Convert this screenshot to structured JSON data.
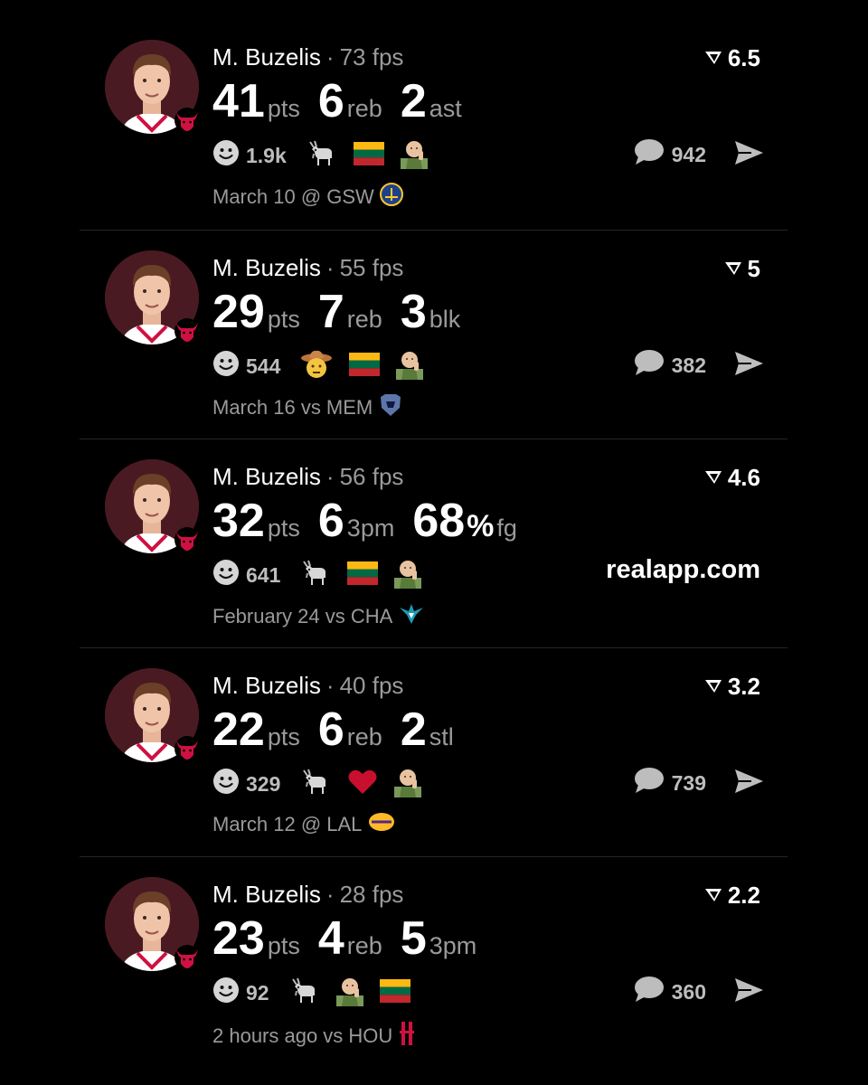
{
  "posts": [
    {
      "player": "M. Buzelis",
      "separator": "·",
      "fps": "73 fps",
      "rating": "6.5",
      "stats": [
        {
          "value": "41",
          "unit": "pts"
        },
        {
          "value": "6",
          "unit": "reb"
        },
        {
          "value": "2",
          "unit": "ast"
        }
      ],
      "reaction_count": "1.9k",
      "reaction_icons": [
        "goat-icon",
        "lithuania-flag-icon",
        "success-kid-icon"
      ],
      "comment_count": "942",
      "game": "March 10 @ GSW",
      "opponent_logo": "warriors-logo-icon"
    },
    {
      "player": "M. Buzelis",
      "separator": "·",
      "fps": "55 fps",
      "rating": "5",
      "stats": [
        {
          "value": "29",
          "unit": "pts"
        },
        {
          "value": "7",
          "unit": "reb"
        },
        {
          "value": "3",
          "unit": "blk"
        }
      ],
      "reaction_count": "544",
      "reaction_icons": [
        "cowboy-face-icon",
        "lithuania-flag-icon",
        "success-kid-icon"
      ],
      "comment_count": "382",
      "game": "March 16 vs MEM",
      "opponent_logo": "grizzlies-logo-icon"
    },
    {
      "player": "M. Buzelis",
      "separator": "·",
      "fps": "56 fps",
      "rating": "4.6",
      "stats": [
        {
          "value": "32",
          "unit": "pts"
        },
        {
          "value": "6",
          "unit": "3pm"
        },
        {
          "value": "68",
          "pct": "%",
          "unit": "fg"
        }
      ],
      "reaction_count": "641",
      "reaction_icons": [
        "goat-icon",
        "lithuania-flag-icon",
        "success-kid-icon"
      ],
      "watermark": "realapp.com",
      "game": "February 24 vs CHA",
      "opponent_logo": "hornets-logo-icon"
    },
    {
      "player": "M. Buzelis",
      "separator": "·",
      "fps": "40 fps",
      "rating": "3.2",
      "stats": [
        {
          "value": "22",
          "unit": "pts"
        },
        {
          "value": "6",
          "unit": "reb"
        },
        {
          "value": "2",
          "unit": "stl"
        }
      ],
      "reaction_count": "329",
      "reaction_icons": [
        "goat-icon",
        "red-heart-icon",
        "success-kid-icon"
      ],
      "comment_count": "739",
      "game": "March 12 @ LAL",
      "opponent_logo": "lakers-logo-icon"
    },
    {
      "player": "M. Buzelis",
      "separator": "·",
      "fps": "28 fps",
      "rating": "2.2",
      "stats": [
        {
          "value": "23",
          "unit": "pts"
        },
        {
          "value": "4",
          "unit": "reb"
        },
        {
          "value": "5",
          "unit": "3pm"
        }
      ],
      "reaction_count": "92",
      "reaction_icons": [
        "goat-icon",
        "success-kid-icon",
        "lithuania-flag-icon"
      ],
      "comment_count": "360",
      "game": "2 hours ago vs HOU",
      "opponent_logo": "rockets-logo-icon"
    }
  ],
  "colors": {
    "background": "#000000",
    "avatar_bg": "#4a1a22",
    "muted_text": "#9a9a9a",
    "divider": "#262626",
    "bulls_red": "#ce1141"
  }
}
